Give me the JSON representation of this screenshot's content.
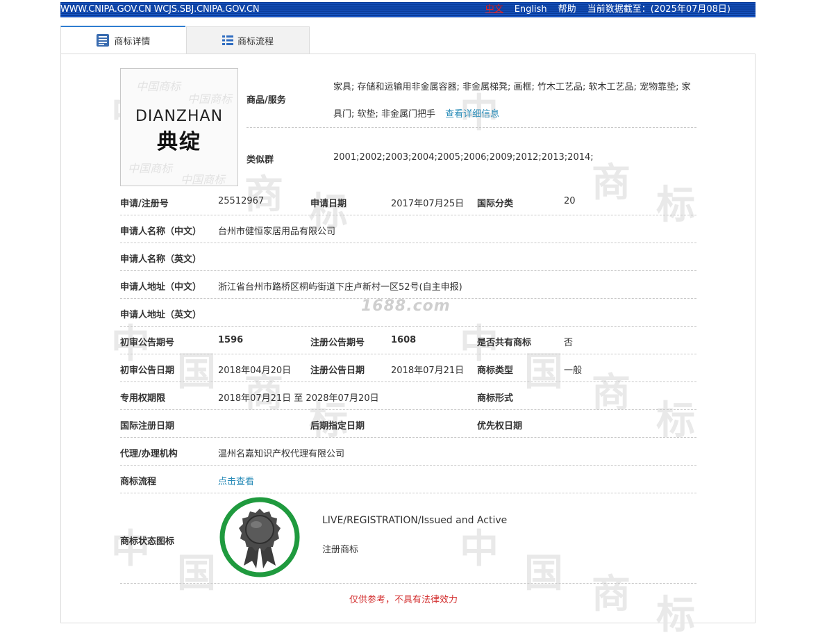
{
  "topbar": {
    "urls": "WWW.CNIPA.GOV.CN WCJS.SBJ.CNIPA.GOV.CN",
    "lang_zh": "中文",
    "lang_en": "English",
    "help": "帮助",
    "data_date": "当前数据截至：(2025年07月08日)"
  },
  "tabs": {
    "detail": "商标详情",
    "flow": "商标流程"
  },
  "watermark": {
    "site": "1688.com",
    "chars": [
      "中",
      "国",
      "商",
      "标"
    ]
  },
  "logo": {
    "text_en": "DIANZHAN",
    "text_zh": "典绽"
  },
  "goods": {
    "label": "商品/服务",
    "text": "家具; 存储和运输用非金属容器; 非金属梯凳; 画框; 竹木工艺品; 软木工艺品; 宠物靠垫; 家具门; 软垫; 非金属门把手",
    "detail_link": "查看详细信息"
  },
  "similar_group": {
    "label": "类似群",
    "value": "2001;2002;2003;2004;2005;2006;2009;2012;2013;2014;"
  },
  "fields": {
    "reg_no_label": "申请/注册号",
    "reg_no": "25512967",
    "apply_date_label": "申请日期",
    "apply_date": "2017年07月25日",
    "intl_class_label": "国际分类",
    "intl_class": "20",
    "applicant_cn_label": "申请人名称（中文）",
    "applicant_cn": "台州市健恒家居用品有限公司",
    "applicant_en_label": "申请人名称（英文）",
    "applicant_en": "",
    "address_cn_label": "申请人地址（中文）",
    "address_cn": "浙江省台州市路桥区桐屿街道下庄卢新村一区52号(自主申报)",
    "address_en_label": "申请人地址（英文）",
    "address_en": "",
    "prelim_no_label": "初审公告期号",
    "prelim_no": "1596",
    "reg_notice_no_label": "注册公告期号",
    "reg_notice_no": "1608",
    "shared_label": "是否共有商标",
    "shared": "否",
    "prelim_date_label": "初审公告日期",
    "prelim_date": "2018年04月20日",
    "reg_notice_date_label": "注册公告日期",
    "reg_notice_date": "2018年07月21日",
    "tm_type_label": "商标类型",
    "tm_type": "一般",
    "exclusive_label": "专用权期限",
    "exclusive": "2018年07月21日 至 2028年07月20日",
    "tm_form_label": "商标形式",
    "tm_form": "",
    "intl_reg_date_label": "国际注册日期",
    "intl_reg_date": "",
    "later_date_label": "后期指定日期",
    "later_date": "",
    "priority_date_label": "优先权日期",
    "priority_date": "",
    "agent_label": "代理/办理机构",
    "agent": "温州名嘉知识产权代理有限公司",
    "flow_label": "商标流程",
    "flow_link": "点击查看",
    "status_icon_label": "商标状态图标"
  },
  "status": {
    "en": "LIVE/REGISTRATION/Issued and Active",
    "zh": "注册商标"
  },
  "disclaimer": "仅供参考，不具有法律效力",
  "colors": {
    "topbar": "#1d5fd2",
    "link": "#2a8cb8",
    "badge_ring": "#1f9a3e",
    "disclaimer": "#d32f2f"
  }
}
